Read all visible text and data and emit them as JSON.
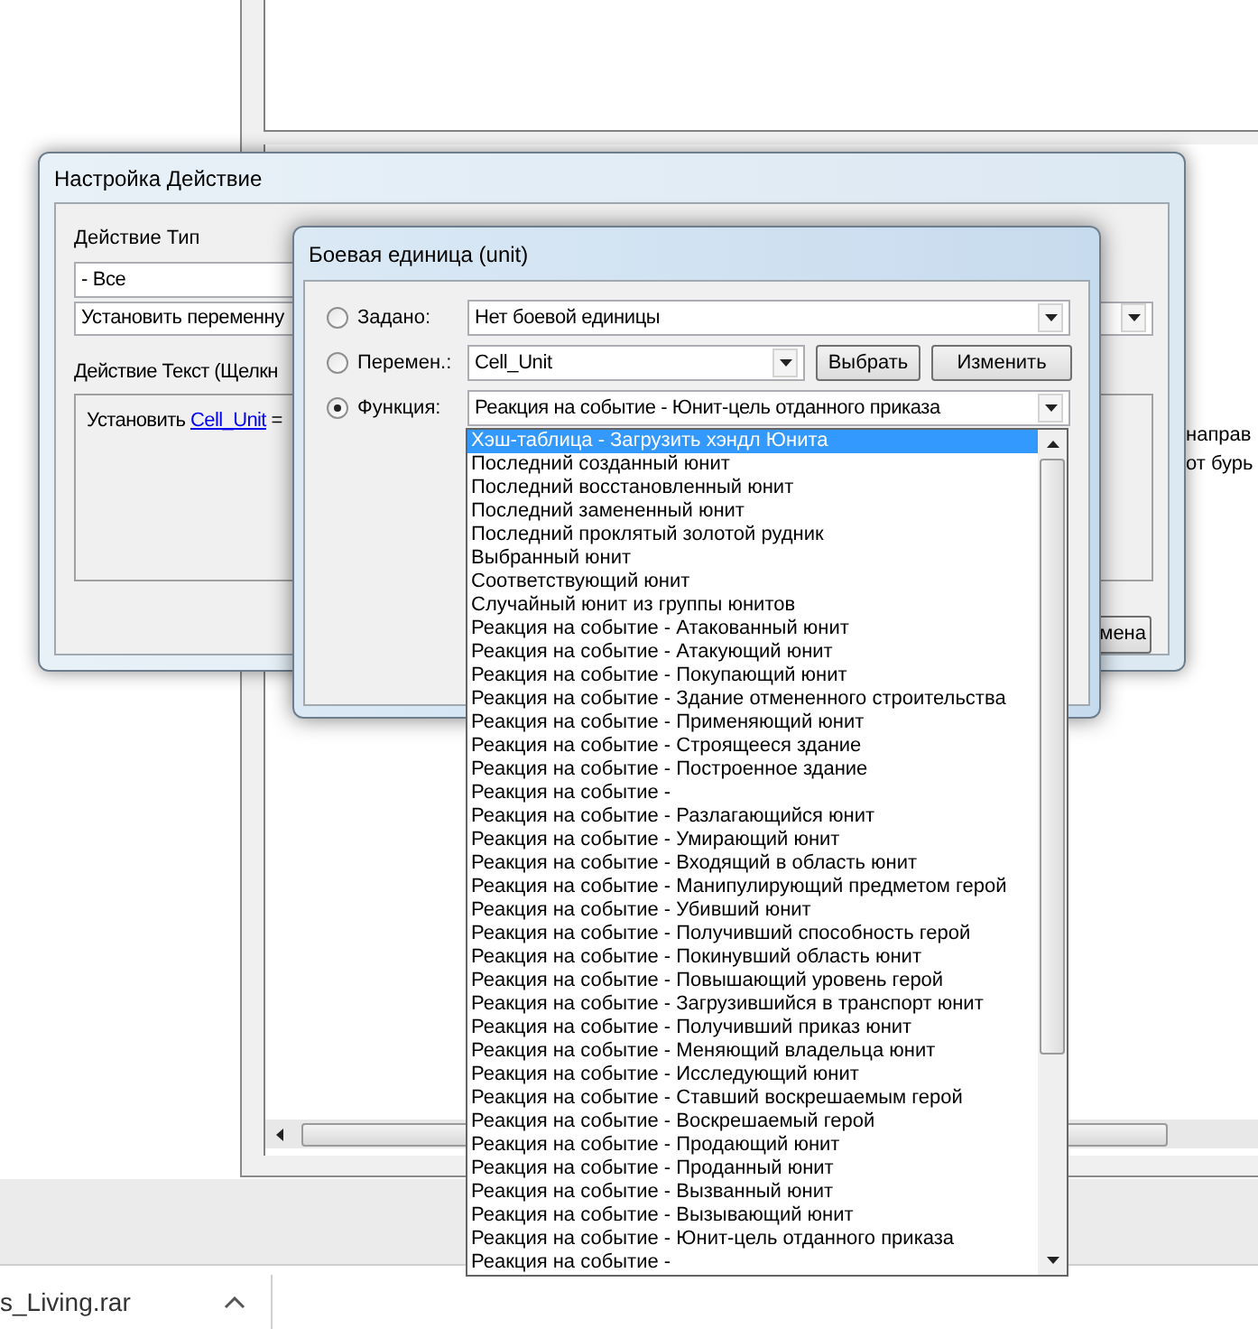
{
  "background_window": {
    "text_fragments": [
      "направ",
      "от бурь"
    ]
  },
  "action_dialog": {
    "title": "Настройка Действие",
    "type_label": "Действие Тип",
    "category": "- Все",
    "action": "Установить переменну",
    "text_label": "Действие Текст (Щелкн",
    "text_prefix": "Установить",
    "text_link": "Cell_Unit",
    "text_suffix": "=",
    "cancel_button": "мена"
  },
  "unit_dialog": {
    "title": "Боевая единица (unit)",
    "options": [
      {
        "kind": "preset",
        "label": "Задано:",
        "selected": false,
        "value": "Нет боевой единицы"
      },
      {
        "kind": "variable",
        "label": "Перемен.:",
        "selected": false,
        "value": "Cell_Unit",
        "buttons": [
          "Выбрать",
          "Изменить"
        ]
      },
      {
        "kind": "function",
        "label": "Функция:",
        "selected": true,
        "value": "Реакция на событие - Юнит-цель отданного приказа"
      }
    ],
    "function_list": [
      {
        "label": "Хэш-таблица - Загрузить хэндл Юнита",
        "selected": true
      },
      {
        "label": "Последний созданный юнит",
        "selected": false
      },
      {
        "label": "Последний восстановленный юнит",
        "selected": false
      },
      {
        "label": "Последний замененный юнит",
        "selected": false
      },
      {
        "label": "Последний проклятый золотой рудник",
        "selected": false
      },
      {
        "label": "Выбранный юнит",
        "selected": false
      },
      {
        "label": "Соответствующий юнит",
        "selected": false
      },
      {
        "label": "Случайный юнит из группы юнитов",
        "selected": false
      },
      {
        "label": "Реакция на событие - Атакованный юнит",
        "selected": false
      },
      {
        "label": "Реакция на событие - Атакующий юнит",
        "selected": false
      },
      {
        "label": "Реакция на событие - Покупающий юнит",
        "selected": false
      },
      {
        "label": "Реакция на событие - Здание отмененного строительства",
        "selected": false
      },
      {
        "label": "Реакция на событие - Применяющий юнит",
        "selected": false
      },
      {
        "label": "Реакция на событие - Строящееся здание",
        "selected": false
      },
      {
        "label": "Реакция на событие - Построенное здание",
        "selected": false
      },
      {
        "label": "Реакция на событие -",
        "selected": false
      },
      {
        "label": "Реакция на событие - Разлагающийся юнит",
        "selected": false
      },
      {
        "label": "Реакция на событие - Умирающий юнит",
        "selected": false
      },
      {
        "label": "Реакция на событие - Входящий в область юнит",
        "selected": false
      },
      {
        "label": "Реакция на событие - Манипулирующий предметом герой",
        "selected": false
      },
      {
        "label": "Реакция на событие - Убивший юнит",
        "selected": false
      },
      {
        "label": "Реакция на событие - Получивший способность герой",
        "selected": false
      },
      {
        "label": "Реакция на событие - Покинувший область юнит",
        "selected": false
      },
      {
        "label": "Реакция на событие - Повышающий уровень герой",
        "selected": false
      },
      {
        "label": "Реакция на событие - Загрузившийся в транспорт юнит",
        "selected": false
      },
      {
        "label": "Реакция на событие - Получивший приказ юнит",
        "selected": false
      },
      {
        "label": "Реакция на событие - Меняющий владельца юнит",
        "selected": false
      },
      {
        "label": "Реакция на событие - Исследующий юнит",
        "selected": false
      },
      {
        "label": "Реакция на событие - Ставший воскрешаемым герой",
        "selected": false
      },
      {
        "label": "Реакция на событие - Воскрешаемый герой",
        "selected": false
      },
      {
        "label": "Реакция на событие - Продающий юнит",
        "selected": false
      },
      {
        "label": "Реакция на событие - Проданный юнит",
        "selected": false
      },
      {
        "label": "Реакция на событие - Вызванный юнит",
        "selected": false
      },
      {
        "label": "Реакция на событие - Вызывающий юнит",
        "selected": false
      },
      {
        "label": "Реакция на событие - Юнит-цель отданного приказа",
        "selected": false
      },
      {
        "label": "Реакция на событие -",
        "selected": false
      }
    ]
  },
  "download_bar": {
    "file": "s_Living.rar"
  }
}
